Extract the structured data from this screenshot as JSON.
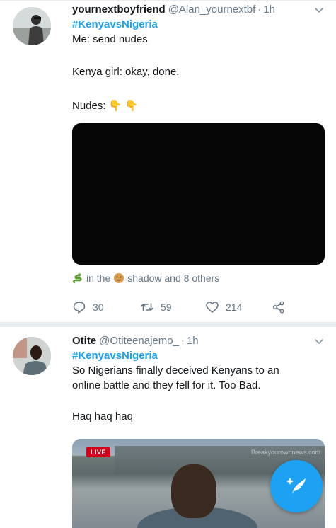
{
  "tweets": [
    {
      "display_name": "yournextboyfriend",
      "handle": "@Alan_yournextbf",
      "separator": "·",
      "time": "1h",
      "hashtag": "#KenyavsNigeria",
      "lines": [
        "Me: send nudes",
        "Kenya girl: okay,  done.",
        "Nudes:"
      ],
      "nudes_emoji": "👇 👇",
      "social_context": {
        "prefix": "in the",
        "middle": "shadow and 8 others"
      },
      "stats": {
        "replies": "30",
        "retweets": "59",
        "likes": "214"
      }
    },
    {
      "display_name": "Otite",
      "handle": "@Otiteenajemo_",
      "separator": "·",
      "time": "1h",
      "hashtag": "#KenyavsNigeria",
      "lines": [
        "So Nigerians finally deceived Kenyans to an",
        "online battle and they fell for it. Too Bad.",
        "Haq haq haq"
      ],
      "video": {
        "live_label": "LIVE",
        "watermark": "Breakyourownnews.com"
      }
    }
  ],
  "icons": {
    "reply": "reply-icon",
    "retweet": "retweet-icon",
    "like": "heart-icon",
    "share": "share-icon",
    "menu": "chevron-down-icon",
    "compose": "compose-tweet-icon"
  },
  "colors": {
    "accent": "#1da1f2",
    "muted": "#657786",
    "text": "#14171a"
  }
}
